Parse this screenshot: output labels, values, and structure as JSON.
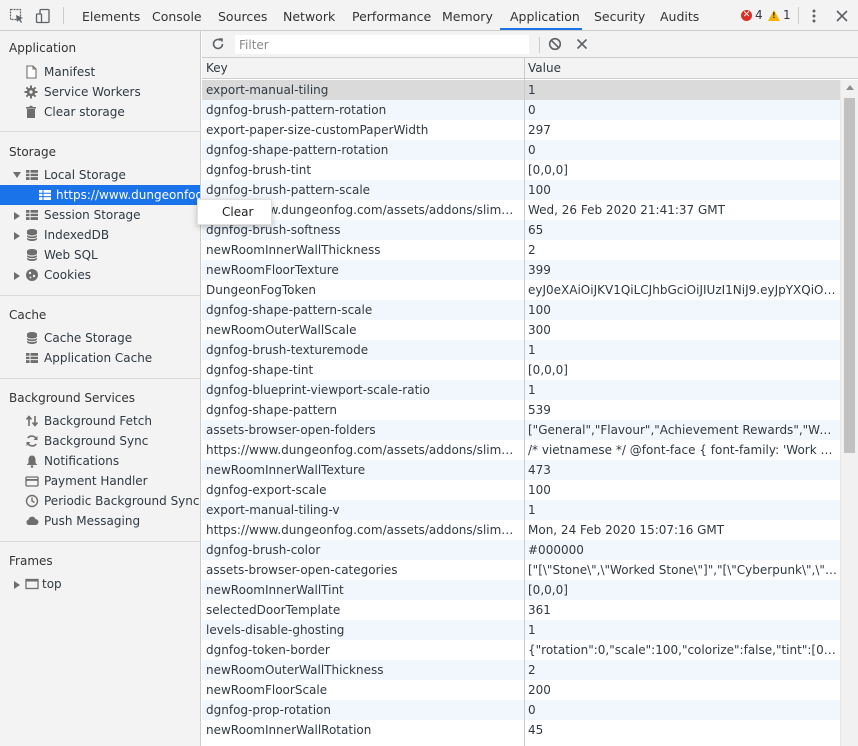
{
  "tabs": [
    "Elements",
    "Console",
    "Sources",
    "Network",
    "Performance",
    "Memory",
    "Application",
    "Security",
    "Audits"
  ],
  "active_tab": "Application",
  "status": {
    "errors": "4",
    "warnings": "1"
  },
  "colors": {
    "accent": "#1a73e8",
    "error": "#d93025",
    "warning": "#f4b400"
  },
  "sidebar": {
    "application_title": "Application",
    "application_items": [
      "Manifest",
      "Service Workers",
      "Clear storage"
    ],
    "storage_title": "Storage",
    "local_storage": "Local Storage",
    "local_storage_origin": "https://www.dungeonfog.com",
    "storage_items": [
      "Session Storage",
      "IndexedDB",
      "Web SQL",
      "Cookies"
    ],
    "cache_title": "Cache",
    "cache_items": [
      "Cache Storage",
      "Application Cache"
    ],
    "bg_title": "Background Services",
    "bg_items": [
      "Background Fetch",
      "Background Sync",
      "Notifications",
      "Payment Handler",
      "Periodic Background Sync",
      "Push Messaging"
    ],
    "frames_title": "Frames",
    "frames_top": "top"
  },
  "context_menu": {
    "clear": "Clear"
  },
  "toolbar": {
    "filter_placeholder": "Filter"
  },
  "grid": {
    "key_header": "Key",
    "value_header": "Value",
    "rows": [
      {
        "key": "export-manual-tiling",
        "value": "1"
      },
      {
        "key": "dgnfog-brush-pattern-rotation",
        "value": "0"
      },
      {
        "key": "export-paper-size-customPaperWidth",
        "value": "297"
      },
      {
        "key": "dgnfog-shape-pattern-rotation",
        "value": "0"
      },
      {
        "key": "dgnfog-brush-tint",
        "value": "[0,0,0]"
      },
      {
        "key": "dgnfog-brush-pattern-scale",
        "value": "100"
      },
      {
        "key": "https://www.dungeonfog.com/assets/addons/slimdaxo/p...",
        "value": "Wed, 26 Feb 2020 21:41:37 GMT"
      },
      {
        "key": "dgnfog-brush-softness",
        "value": "65"
      },
      {
        "key": "newRoomInnerWallThickness",
        "value": "2"
      },
      {
        "key": "newRoomFloorTexture",
        "value": "399"
      },
      {
        "key": "DungeonFogToken",
        "value": "eyJ0eXAiOiJKV1QiLCJhbGciOiJIUzI1NiJ9.eyJpYXQiOjE1OD..."
      },
      {
        "key": "dgnfog-shape-pattern-scale",
        "value": "100"
      },
      {
        "key": "newRoomOuterWallScale",
        "value": "300"
      },
      {
        "key": "dgnfog-brush-texturemode",
        "value": "1"
      },
      {
        "key": "dgnfog-shape-tint",
        "value": "[0,0,0]"
      },
      {
        "key": "dgnfog-blueprint-viewport-scale-ratio",
        "value": "1"
      },
      {
        "key": "dgnfog-shape-pattern",
        "value": "539"
      },
      {
        "key": "assets-browser-open-folders",
        "value": "[\"General\",\"Flavour\",\"Achievement Rewards\",\"Wood\"]"
      },
      {
        "key": "https://www.dungeonfog.com/assets/addons/slimdaxo/p...",
        "value": "/* vietnamese */ @font-face { font-family: 'Work Sans'; fo..."
      },
      {
        "key": "newRoomInnerWallTexture",
        "value": "473"
      },
      {
        "key": "dgnfog-export-scale",
        "value": "100"
      },
      {
        "key": "export-manual-tiling-v",
        "value": "1"
      },
      {
        "key": "https://www.dungeonfog.com/assets/addons/slimdaxo/p...",
        "value": "Mon, 24 Feb 2020 15:07:16 GMT"
      },
      {
        "key": "dgnfog-brush-color",
        "value": "#000000"
      },
      {
        "key": "assets-browser-open-categories",
        "value": "[\"[\\\"Stone\\\",\\\"Worked Stone\\\"]\",\"[\\\"Cyberpunk\\\",\\\"Cyberp..."
      },
      {
        "key": "newRoomInnerWallTint",
        "value": "[0,0,0]"
      },
      {
        "key": "selectedDoorTemplate",
        "value": "361"
      },
      {
        "key": "levels-disable-ghosting",
        "value": "1"
      },
      {
        "key": "dgnfog-token-border",
        "value": "{\"rotation\":0,\"scale\":100,\"colorize\":false,\"tint\":[0,1,0.5],\"tex..."
      },
      {
        "key": "newRoomOuterWallThickness",
        "value": "2"
      },
      {
        "key": "newRoomFloorScale",
        "value": "200"
      },
      {
        "key": "dgnfog-prop-rotation",
        "value": "0"
      },
      {
        "key": "newRoomInnerWallRotation",
        "value": "45"
      }
    ]
  }
}
